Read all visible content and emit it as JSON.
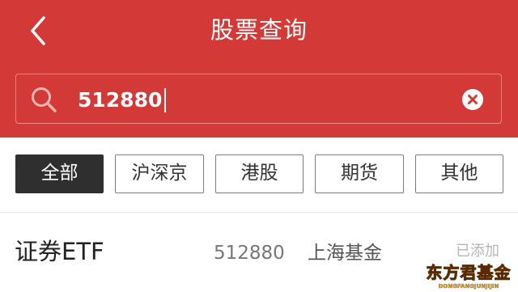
{
  "header": {
    "title": "股票查询",
    "background_color": "#d33a37"
  },
  "search": {
    "value": "512880",
    "icon": "search-icon",
    "clear_icon": "clear-icon"
  },
  "filter_tabs": [
    {
      "label": "全部",
      "active": true
    },
    {
      "label": "沪深京",
      "active": false
    },
    {
      "label": "港股",
      "active": false
    },
    {
      "label": "期货",
      "active": false
    },
    {
      "label": "其他",
      "active": false
    }
  ],
  "results": [
    {
      "name": "证券ETF",
      "code": "512880",
      "market": "上海基金",
      "status": "已添加"
    }
  ],
  "watermark": {
    "text": "东方君基金",
    "subtext": "DONGFANGJUNJIJIN"
  }
}
